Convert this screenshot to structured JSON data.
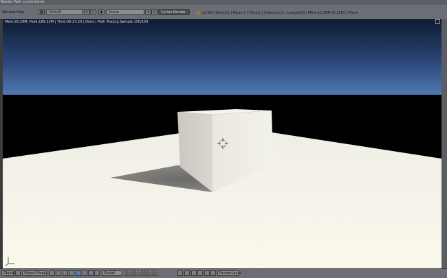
{
  "window": {
    "title": "Render Path cycles.blend"
  },
  "info_header": {
    "menus": [
      "Window",
      "Help"
    ],
    "screen_layout": "Default",
    "scene": "Scene",
    "render_engine": "Cycles Render",
    "status": "v2.60 | Verts:12 | Faces:7 | Tris:12 | Objects:1/3 | Lamps:0/0 | Mem:11.36M (0.11M) | Plane"
  },
  "viewport": {
    "info": "Mem:93.29M, Peak:189.22M | Time:00:23.20 | Done | Path Tracing Sample 150/150",
    "colors": {
      "sky_top": "#0e1b33",
      "sky_horizon": "#4f78b4",
      "floor": "#f8f5ea",
      "shadow": "#6a6a68"
    }
  },
  "footer": {
    "object_menu": "Object",
    "mode": "Object Mode",
    "orientation": "Global",
    "render_layer": "RenderLayer"
  }
}
